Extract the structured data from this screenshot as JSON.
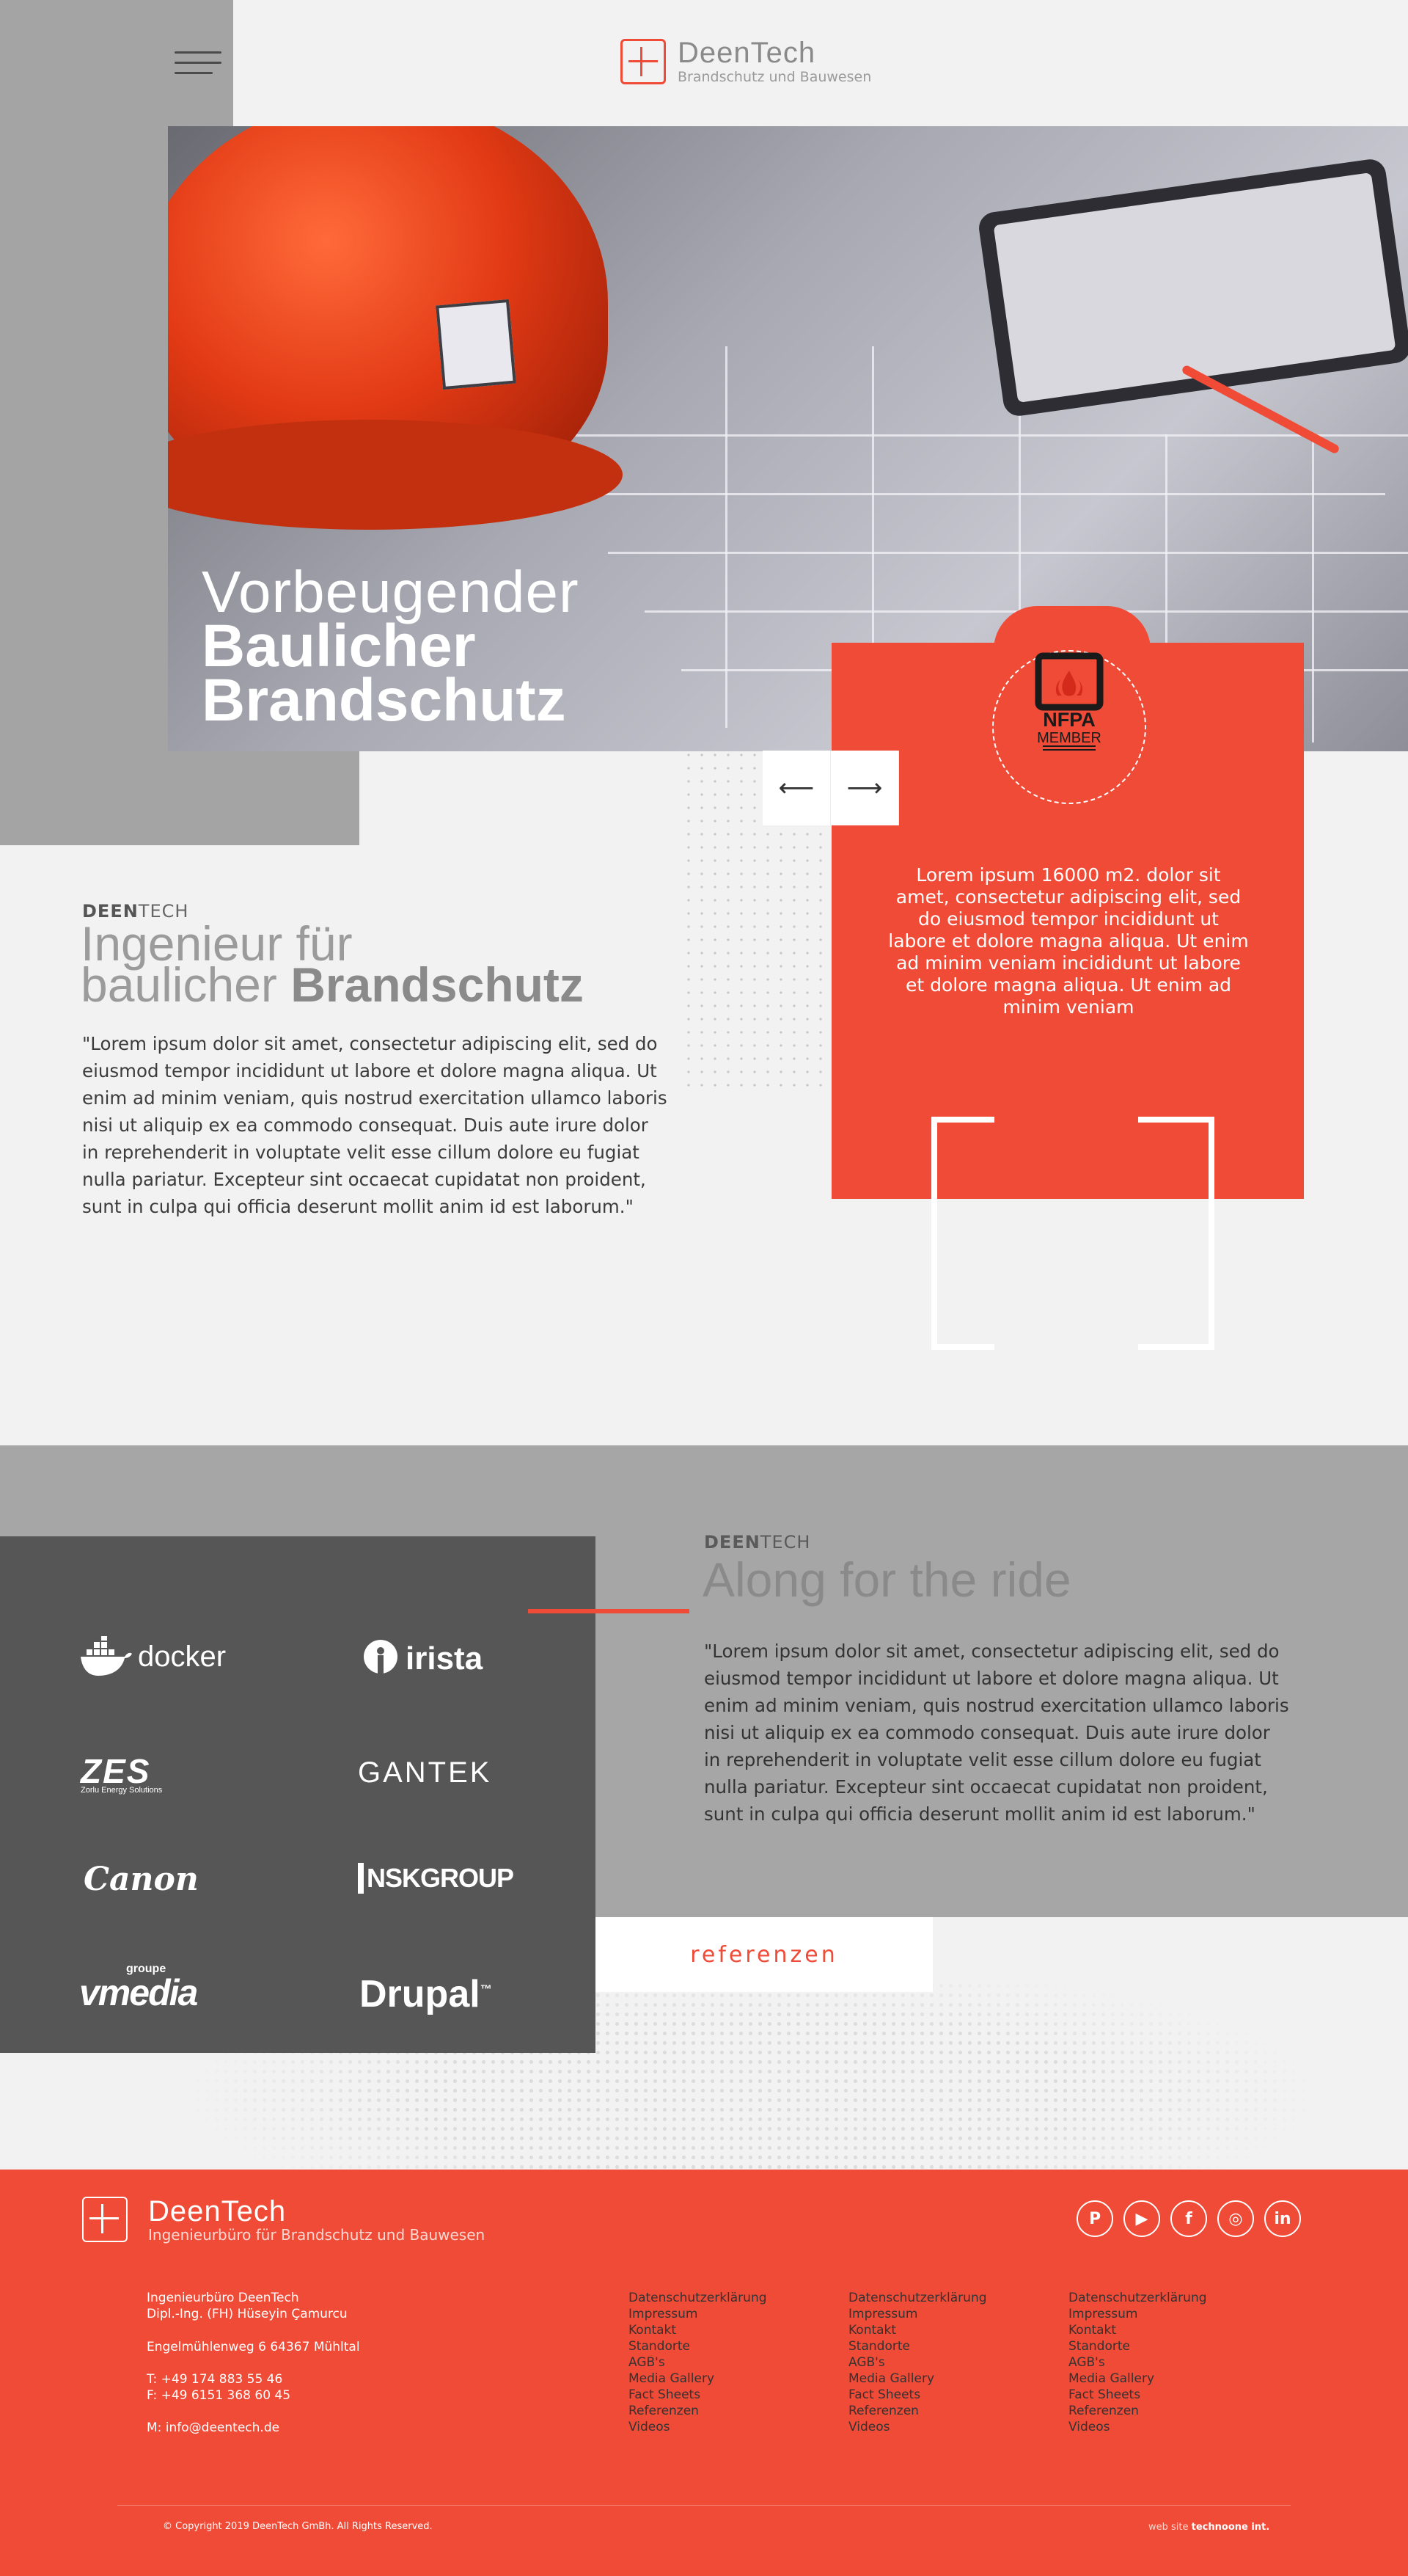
{
  "header": {
    "brand_name": "DeenTech",
    "brand_tagline": "Brandschutz und Bauwesen"
  },
  "hero": {
    "line1": "Vorbeugender",
    "line2": "Baulicher",
    "line3": "Brandschutz"
  },
  "badge": {
    "top": "NFPA",
    "bottom": "MEMBER"
  },
  "card": {
    "text": "Lorem ipsum 16000 m2. dolor sit amet, consectetur adipiscing elit, sed do eiusmod tempor incididunt ut labore et dolore magna aliqua. Ut enim ad minim veniam incididunt ut labore et dolore magna aliqua. Ut enim ad minim veniam"
  },
  "slider": {
    "prev": "⟵",
    "next": "⟶"
  },
  "intro": {
    "brand_bold": "DEEN",
    "brand_light": "TECH",
    "heading_line1": "Ingenieur für",
    "heading_line2_light": "baulicher",
    "heading_line2_bold": "Brandschutz",
    "text": "\"Lorem ipsum dolor sit amet, consectetur adipiscing elit, sed do eiusmod tempor incididunt ut labore et dolore magna aliqua. Ut enim ad minim veniam, quis nostrud exercitation ullamco laboris nisi ut aliquip ex ea commodo consequat. Duis aute irure dolor in reprehenderit in voluptate velit esse cillum dolore eu fugiat nulla pariatur. Excepteur sint occaecat cupidatat non proident, sunt in culpa qui officia deserunt mollit anim id est laborum.\""
  },
  "clients": {
    "docker": "docker",
    "irista": "irista",
    "zes": "ZES",
    "zes_sub": "Zorlu Energy Solutions",
    "gantek": "GANTEK",
    "canon": "Canon",
    "nsk": "NSKGROUP",
    "vmedia_top": "groupe",
    "vmedia": "vmedia",
    "drupal": "Drupal",
    "drupal_tm": "™"
  },
  "ride": {
    "brand_bold": "DEEN",
    "brand_light": "TECH",
    "heading": "Along for the ride",
    "text": "\"Lorem ipsum dolor sit amet, consectetur adipiscing elit, sed do eiusmod tempor incididunt ut labore et dolore magna aliqua. Ut enim ad minim veniam, quis nostrud exercitation ullamco laboris nisi ut aliquip ex ea commodo consequat. Duis aute irure dolor in reprehenderit in voluptate velit esse cillum dolore eu fugiat nulla pariatur. Excepteur sint occaecat cupidatat non proident, sunt in culpa qui officia deserunt mollit anim id est laborum.\"",
    "button": "referenzen"
  },
  "footer": {
    "brand_name": "DeenTech",
    "brand_tagline": "Ingenieurbüro für Brandschutz und Bauwesen",
    "company": "Ingenieurbüro DeenTech",
    "person": "Dipl.-Ing. (FH) Hüseyin Çamurcu",
    "address": "Engelmühlenweg 6 64367 Mühltal",
    "phone": "T:   +49 174 883 55 46",
    "fax": "F:   +49 6151 368 60 45",
    "email": "M:  info@deentech.de",
    "columns": [
      [
        "Datenschutzerklärung",
        "Impressum",
        "Kontakt",
        "Standorte",
        "AGB's",
        "Media Gallery",
        "Fact Sheets",
        "Referenzen",
        "Videos"
      ],
      [
        "Datenschutzerklärung",
        "Impressum",
        "Kontakt",
        "Standorte",
        "AGB's",
        "Media Gallery",
        "Fact Sheets",
        "Referenzen",
        "Videos"
      ],
      [
        "Datenschutzerklärung",
        "Impressum",
        "Kontakt",
        "Standorte",
        "AGB's",
        "Media Gallery",
        "Fact Sheets",
        "Referenzen",
        "Videos"
      ]
    ],
    "socials": [
      "P",
      "▶",
      "f",
      "◎",
      "in"
    ],
    "copyright": "© Copyright 2019   DeenTech GmBh. All Rights Reserved.",
    "webby_label": "web site",
    "webby_name": "technoone int."
  },
  "colors": {
    "accent": "#ef4b37",
    "gray_band": "#a6a6a6",
    "dark_panel": "#565656",
    "background": "#f2f2f2"
  }
}
